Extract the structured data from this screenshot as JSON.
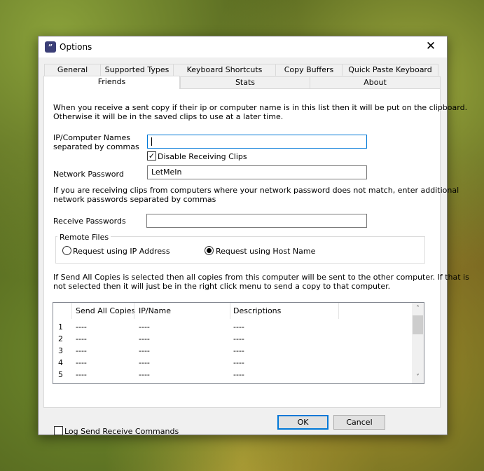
{
  "window": {
    "title": "Options",
    "icon_glyph": "”",
    "close_glyph": "✕"
  },
  "tabs": {
    "row1": [
      "General",
      "Supported Types",
      "Keyboard Shortcuts",
      "Copy Buffers",
      "Quick Paste Keyboard"
    ],
    "row2": [
      "Friends",
      "Stats",
      "About"
    ],
    "active": "Friends"
  },
  "friends": {
    "intro_line1": "When you receive a sent copy if their ip or computer name is in this list then it will be put on the clipboard.",
    "intro_line2": "Otherwise it will be in the saved clips to use at a later time.",
    "ip_label_line1": "IP/Computer Names",
    "ip_label_line2": "separated by commas",
    "ip_value": "",
    "disable_receiving_label": "Disable Receiving Clips",
    "disable_receiving_checked": true,
    "network_password_label": "Network Password",
    "network_password_value": "LetMeIn",
    "extra_pw_line1": "If you are receiving clips from computers where your network password does not match, enter additional",
    "extra_pw_line2": "network passwords separated by commas",
    "receive_passwords_label": "Receive Passwords",
    "receive_passwords_value": "",
    "remote_files_label": "Remote Files",
    "radio_ip_label": "Request using IP Address",
    "radio_host_label": "Request using Host Name",
    "selected_radio": "host",
    "send_all_line1": "If Send All Copies is selected then all copies from this computer will be sent to the other computer.  If that is",
    "send_all_line2": "not selected then it will just be in the right click menu to send a copy to that computer.",
    "log_label": "Log Send Receive Commands",
    "log_checked": false
  },
  "grid": {
    "columns": [
      "Send All Copies",
      "IP/Name",
      "Descriptions"
    ],
    "rows": [
      {
        "num": "1",
        "send": "----",
        "ip": "----",
        "desc": "----"
      },
      {
        "num": "2",
        "send": "----",
        "ip": "----",
        "desc": "----"
      },
      {
        "num": "3",
        "send": "----",
        "ip": "----",
        "desc": "----"
      },
      {
        "num": "4",
        "send": "----",
        "ip": "----",
        "desc": "----"
      },
      {
        "num": "5",
        "send": "----",
        "ip": "----",
        "desc": "----"
      }
    ],
    "scroll_up_glyph": "˄",
    "scroll_down_glyph": "˅"
  },
  "buttons": {
    "ok": "OK",
    "cancel": "Cancel"
  }
}
